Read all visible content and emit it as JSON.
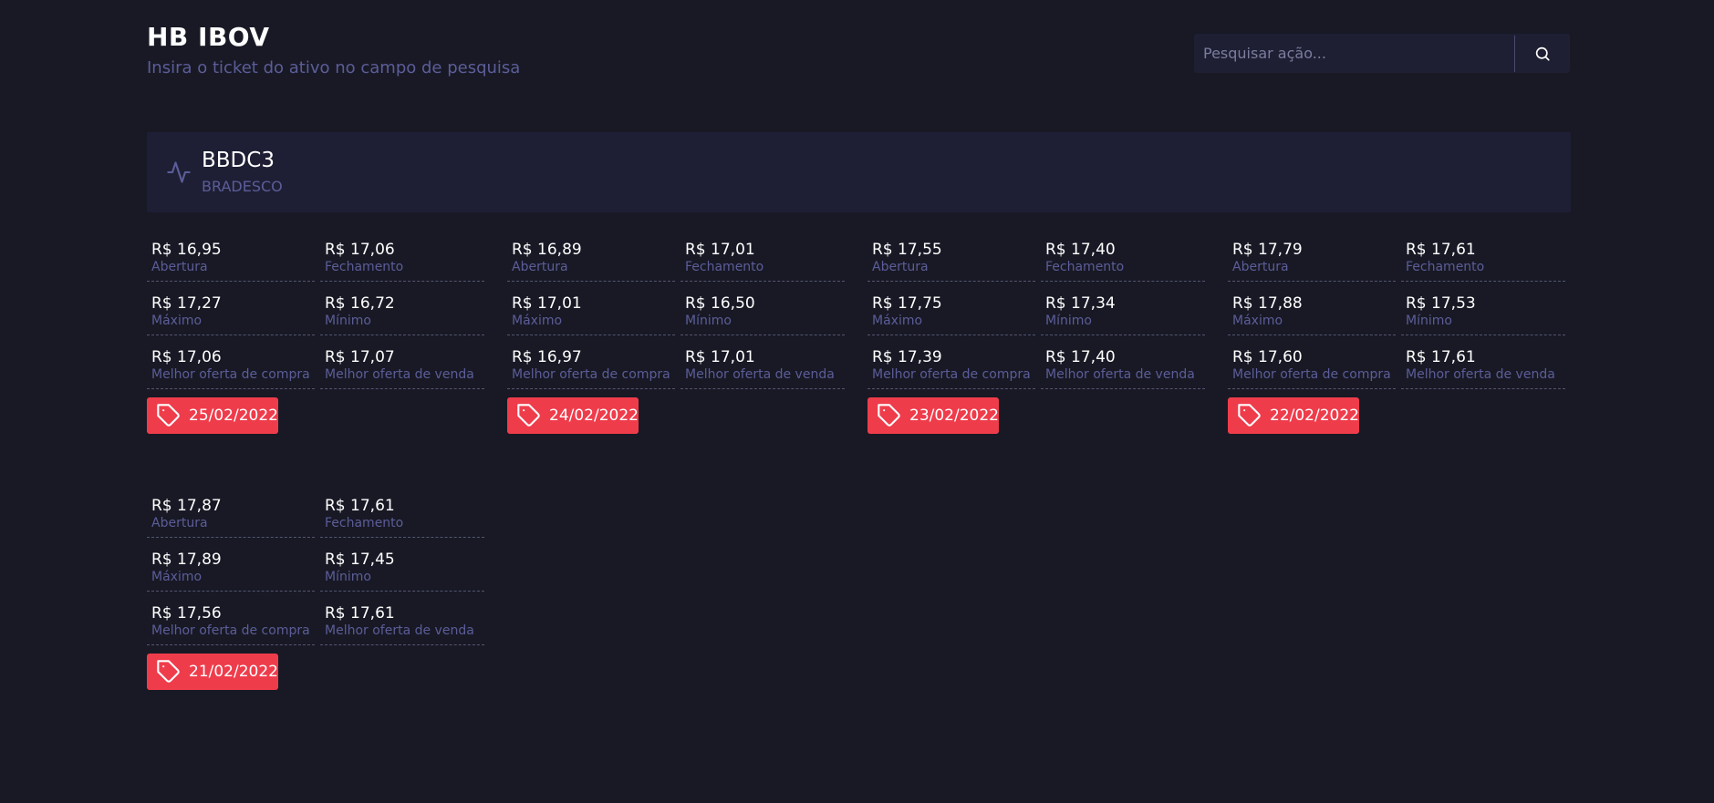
{
  "header": {
    "title": "HB IBOV",
    "subtitle": "Insira o ticket do ativo no campo de pesquisa"
  },
  "search": {
    "placeholder": "Pesquisar ação...",
    "value": ""
  },
  "icons": {
    "search_button": "search-icon",
    "asset": "activity-icon",
    "date_badge": "tag-icon"
  },
  "colors": {
    "background": "#181925",
    "card": "#1e1f35",
    "accent_text": "#5c5d98",
    "badge": "#ef3c4b"
  },
  "asset": {
    "ticker": "BBDC3",
    "name": "BRADESCO"
  },
  "labels": {
    "open": "Abertura",
    "close": "Fechamento",
    "high": "Máximo",
    "low": "Mínimo",
    "best_buy": "Melhor oferta de compra",
    "best_sell": "Melhor oferta de venda"
  },
  "days": [
    {
      "date": "25/02/2022",
      "open": "R$ 16,95",
      "close": "R$ 17,06",
      "high": "R$ 17,27",
      "low": "R$ 16,72",
      "best_buy": "R$ 17,06",
      "best_sell": "R$ 17,07"
    },
    {
      "date": "24/02/2022",
      "open": "R$ 16,89",
      "close": "R$ 17,01",
      "high": "R$ 17,01",
      "low": "R$ 16,50",
      "best_buy": "R$ 16,97",
      "best_sell": "R$ 17,01"
    },
    {
      "date": "23/02/2022",
      "open": "R$ 17,55",
      "close": "R$ 17,40",
      "high": "R$ 17,75",
      "low": "R$ 17,34",
      "best_buy": "R$ 17,39",
      "best_sell": "R$ 17,40"
    },
    {
      "date": "22/02/2022",
      "open": "R$ 17,79",
      "close": "R$ 17,61",
      "high": "R$ 17,88",
      "low": "R$ 17,53",
      "best_buy": "R$ 17,60",
      "best_sell": "R$ 17,61"
    },
    {
      "date": "21/02/2022",
      "open": "R$ 17,87",
      "close": "R$ 17,61",
      "high": "R$ 17,89",
      "low": "R$ 17,45",
      "best_buy": "R$ 17,56",
      "best_sell": "R$ 17,61"
    }
  ]
}
